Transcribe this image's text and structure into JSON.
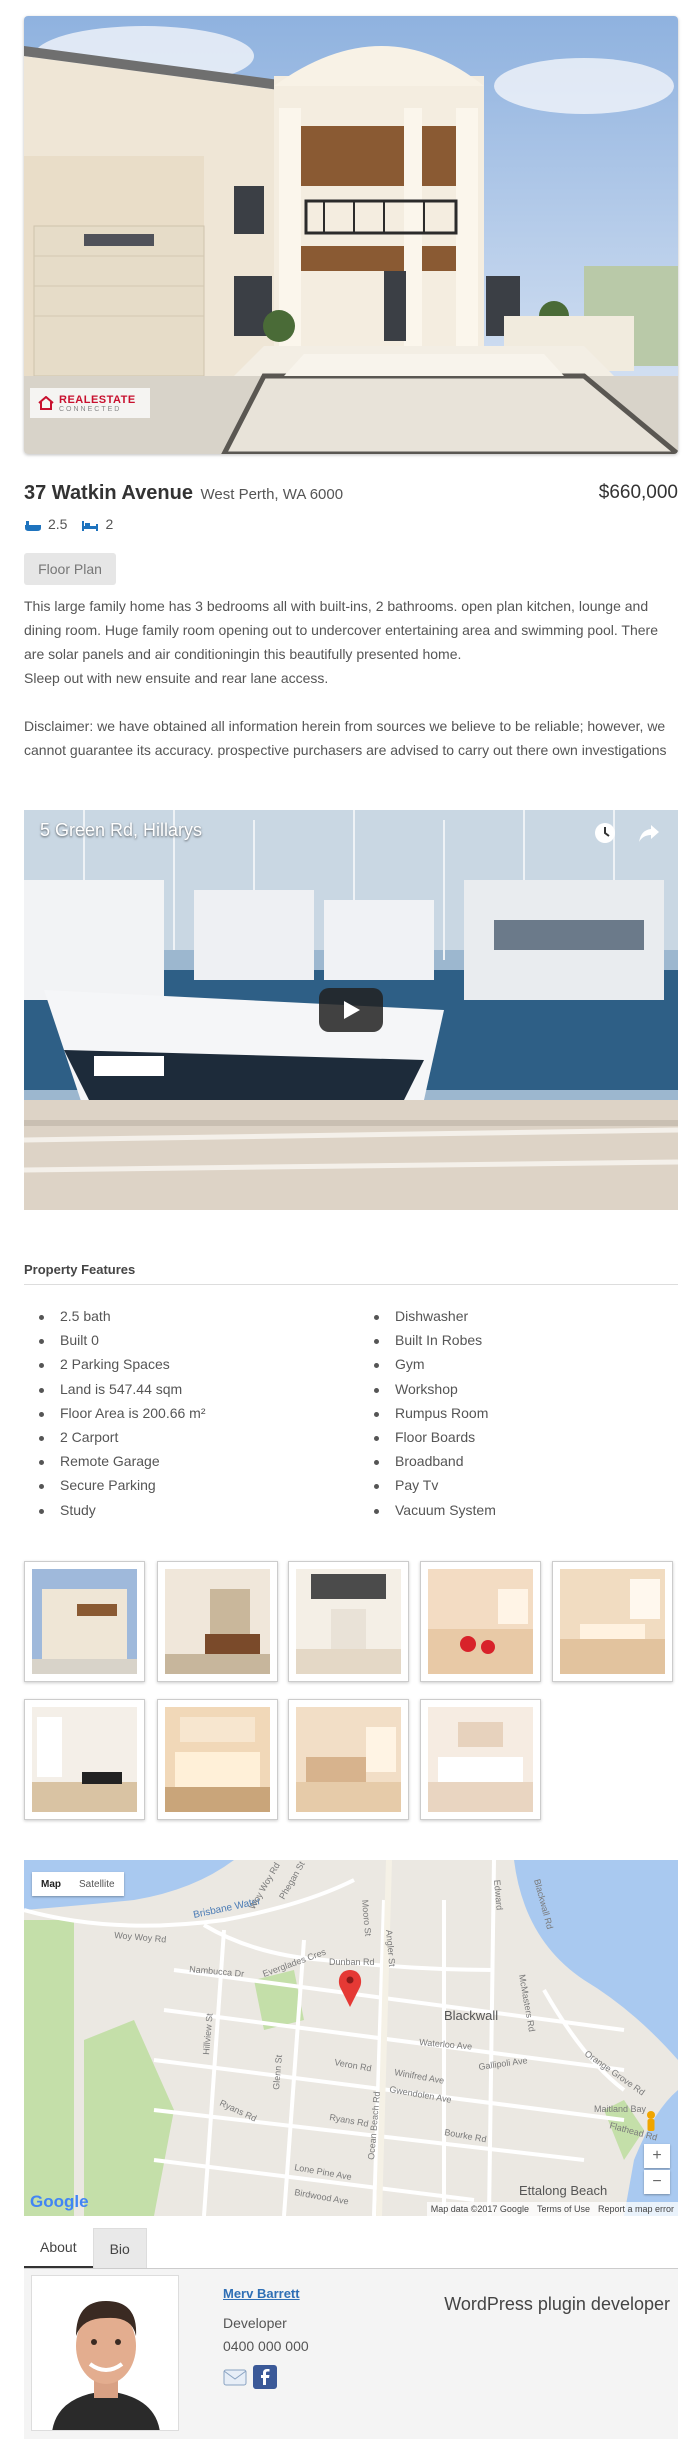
{
  "listing": {
    "address": "37 Watkin Avenue",
    "suburb": "West Perth, WA 6000",
    "price": "$660,000",
    "baths": "2.5",
    "beds": "2",
    "floor_plan_label": "Floor Plan",
    "description_1": "This large family home has 3 bedrooms all with built-ins, 2 bathrooms. open plan kitchen, lounge and dining room. Huge family room opening out to undercover entertaining area and swimming pool. There are solar panels and air conditioningin this beautifully presented home.",
    "description_2": "Sleep out with new ensuite and rear lane access.",
    "disclaimer": "Disclaimer: we have obtained all information herein from sources we believe to be reliable; however, we cannot guarantee its accuracy. prospective purchasers are advised to carry out there own investigations"
  },
  "logo": {
    "name": "REALESTATE",
    "sub": "CONNECTED"
  },
  "video": {
    "title": "5 Green Rd, Hillarys"
  },
  "features": {
    "heading": "Property Features",
    "left": [
      "2.5 bath",
      "Built 0",
      "2 Parking Spaces",
      "Land is 547.44 sqm",
      "Floor Area is 200.66 m²",
      "2 Carport",
      "Remote Garage",
      "Secure Parking",
      "Study"
    ],
    "right": [
      "Dishwasher",
      "Built In Robes",
      "Gym",
      "Workshop",
      "Rumpus Room",
      "Floor Boards",
      "Broadband",
      "Pay Tv",
      "Vacuum System"
    ]
  },
  "map": {
    "map_label": "Map",
    "satellite_label": "Satellite",
    "zoom_in": "+",
    "zoom_out": "−",
    "google": "Google",
    "data": "Map data ©2017 Google",
    "terms": "Terms of Use",
    "report": "Report a map error",
    "streets": [
      "Brisbane Water",
      "Woy Woy Rd",
      "Phegan St",
      "Dunban Rd",
      "Everglades Cres",
      "Nambucca Dr",
      "Hillview St",
      "Glenn St",
      "Ryans Rd",
      "Veron Rd",
      "Winifred Ave",
      "Gwendolen Ave",
      "Gallipoli Ave",
      "Waterloo Ave",
      "Ocean Beach Rd",
      "Bourke Rd",
      "Lone Pine Ave",
      "Birdwood Ave",
      "McMasters Rd",
      "Orange Grove Rd",
      "Maitland Bay",
      "Flathead Rd",
      "Blackwall Rd",
      "Edward",
      "Mooro St",
      "Angler St"
    ],
    "places": [
      "Blackwall",
      "Ettalong Beach"
    ]
  },
  "tabs": {
    "about": "About",
    "bio": "Bio"
  },
  "agent": {
    "name": "Merv Barrett",
    "role": "Developer",
    "phone": "0400 000 000",
    "tagline": "WordPress plugin developer"
  },
  "colors": {
    "accent": "#2f6fb5",
    "bath_icon": "#1e73be",
    "map_pin": "#e53935"
  }
}
